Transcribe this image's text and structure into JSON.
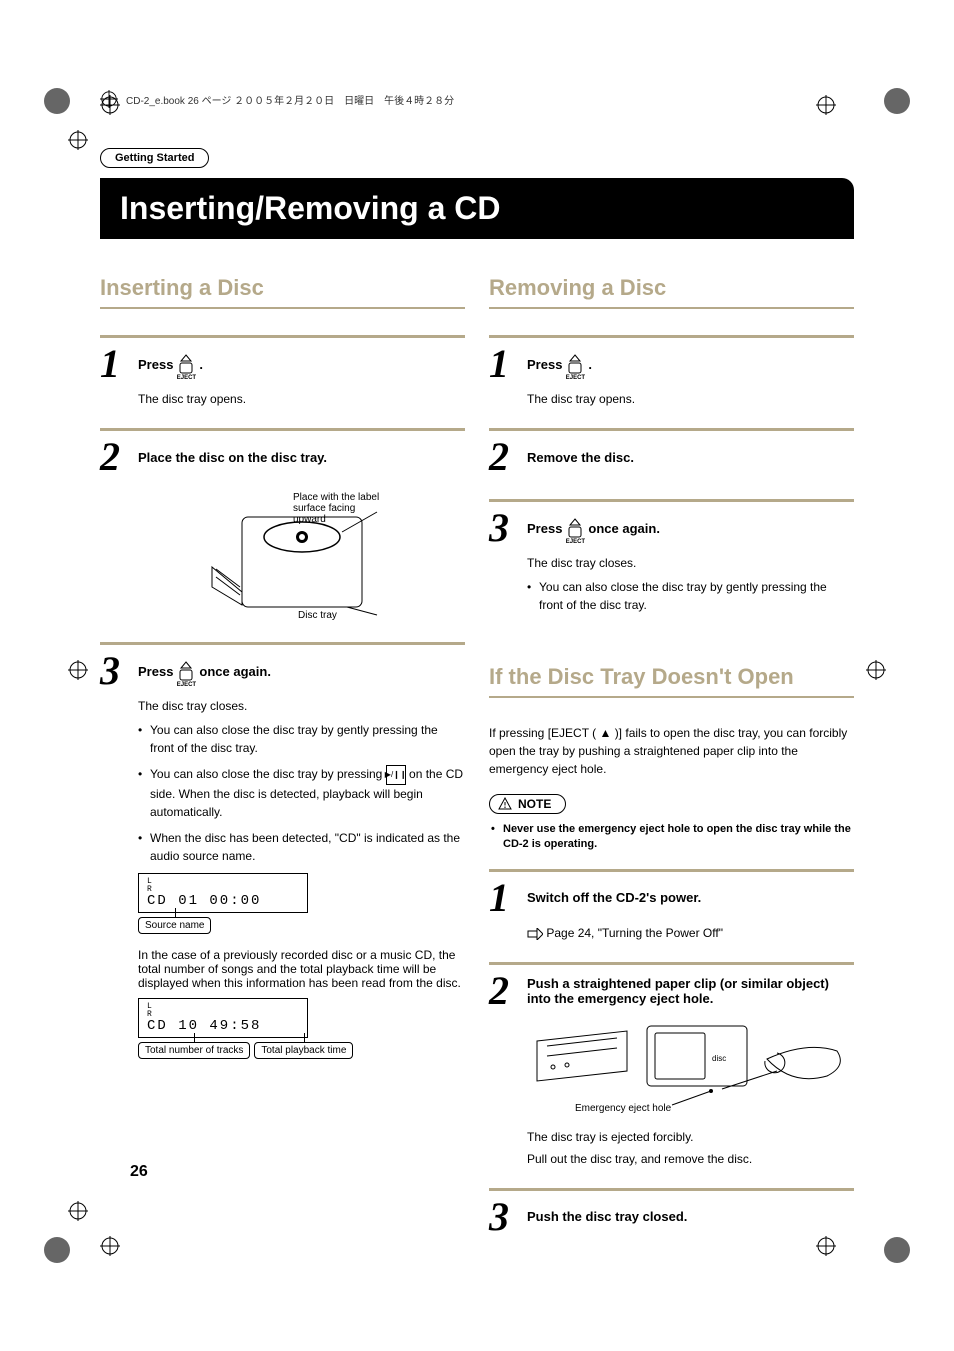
{
  "print_header": "CD-2_e.book  26 ページ  ２００５年２月２０日　日曜日　午後４時２８分",
  "section_tag": "Getting Started",
  "main_title": "Inserting/Removing a CD",
  "inserting": {
    "heading": "Inserting a Disc",
    "steps": [
      {
        "num": "1",
        "press_before": "Press",
        "press_after": ".",
        "eject_label": "EJECT",
        "body": "The disc tray opens."
      },
      {
        "num": "2",
        "title": "Place the disc on the disc tray.",
        "illus_label1": "Place with the label surface facing upward",
        "illus_label2": "Disc tray"
      },
      {
        "num": "3",
        "press_before": "Press",
        "press_mid": "once again.",
        "eject_label": "EJECT",
        "body": "The disc tray closes.",
        "bullets": [
          "You can also close the disc tray by gently pressing the front of the disc tray.",
          "You can also close the disc tray by pressing  [PLAY]  on the CD side. When the disc is detected, playback will begin automatically.",
          "When the disc has been detected, \"CD\" is indicated as the audio source name."
        ],
        "lcd1": {
          "lr": "L\nR",
          "text": "CD   01   00:00"
        },
        "legend_src": "Source name",
        "para2": "In the case of a previously recorded disc or a music CD, the total number of songs and the total playback time will be displayed when this information has been read from the disc.",
        "lcd2": {
          "lr": "L\nR",
          "text": "CD   10   49:58"
        },
        "legend_tracks": "Total number of tracks",
        "legend_time": "Total playback time"
      }
    ]
  },
  "removing": {
    "heading": "Removing a Disc",
    "steps": [
      {
        "num": "1",
        "press_before": "Press",
        "press_after": ".",
        "eject_label": "EJECT",
        "body": "The disc tray opens."
      },
      {
        "num": "2",
        "title": "Remove the disc."
      },
      {
        "num": "3",
        "press_before": "Press",
        "press_mid": "once again.",
        "eject_label": "EJECT",
        "body": "The disc tray closes.",
        "bullets": [
          "You can also close the disc tray by gently pressing the front of the disc tray."
        ]
      }
    ]
  },
  "if_tray": {
    "heading": "If the Disc Tray Doesn't Open",
    "intro": "If pressing [EJECT ( ▲ )] fails to open the disc tray, you can forcibly open the tray by pushing a straightened paper clip into the emergency eject hole.",
    "note_label": "NOTE",
    "note_items": [
      "Never use the emergency eject hole to open the disc tray while the CD-2 is operating."
    ],
    "steps": [
      {
        "num": "1",
        "title": "Switch off the CD-2's power.",
        "ref": "Page 24, \"Turning the Power Off\""
      },
      {
        "num": "2",
        "title": "Push a straightened paper clip (or similar object) into the emergency eject hole.",
        "illus_label": "Emergency eject hole",
        "body1": "The disc tray is ejected forcibly.",
        "body2": "Pull out the disc tray, and remove the disc."
      },
      {
        "num": "3",
        "title": "Push the disc tray closed."
      }
    ]
  },
  "page_num": "26"
}
